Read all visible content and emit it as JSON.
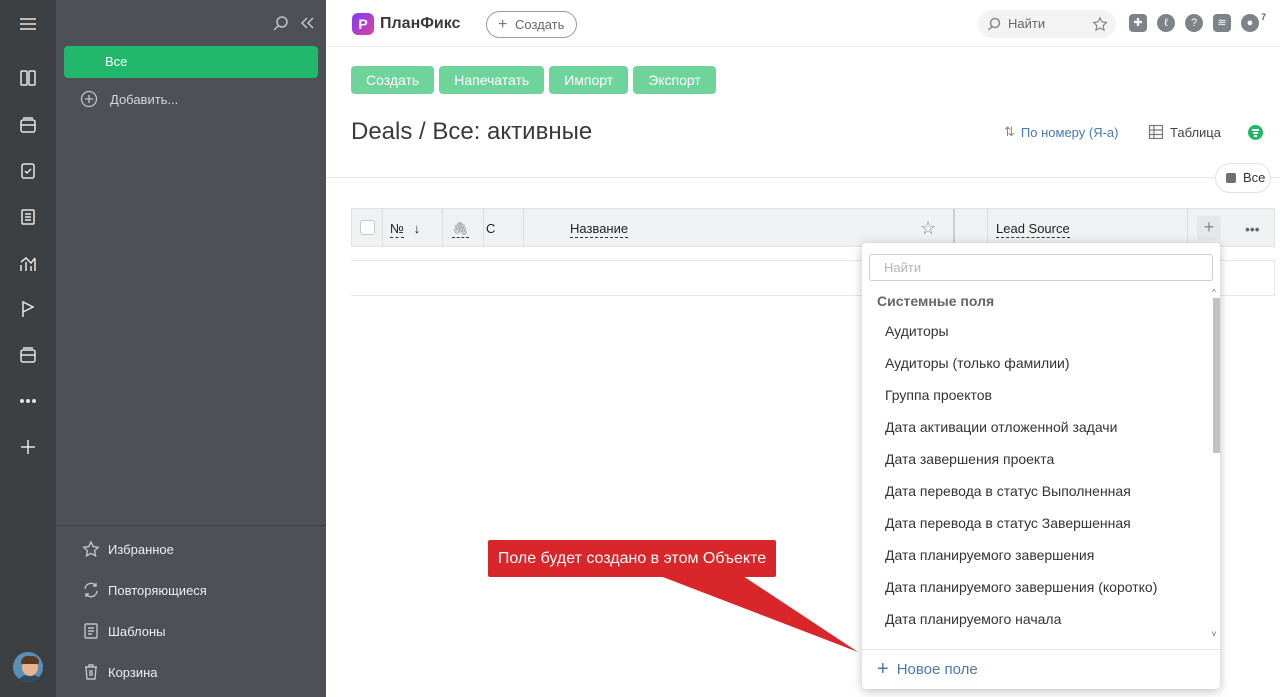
{
  "app": {
    "logo_letter": "P",
    "name": "ПланФикс"
  },
  "header": {
    "create_label": "Создать",
    "search_label": "Найти",
    "notification_count": "7"
  },
  "sidebar": {
    "items": [
      {
        "label": "Все"
      }
    ],
    "add_label": "Добавить...",
    "bottom": [
      {
        "label": "Избранное",
        "icon": "star-icon"
      },
      {
        "label": "Повторяющиеся",
        "icon": "repeat-icon"
      },
      {
        "label": "Шаблоны",
        "icon": "template-icon"
      },
      {
        "label": "Корзина",
        "icon": "trash-icon"
      }
    ]
  },
  "toolbar": {
    "create": "Создать",
    "print": "Напечатать",
    "import": "Импорт",
    "export": "Экспорт"
  },
  "page": {
    "title": "Deals / Все: активные",
    "sort_label": "По номеру (Я-а)",
    "view_label": "Таблица",
    "filter_chip": "Все"
  },
  "table": {
    "columns": {
      "number": "№",
      "c": "С",
      "name": "Название",
      "lead_source": "Lead Source"
    }
  },
  "dropdown": {
    "search_placeholder": "Найти",
    "group_label": "Системные поля",
    "items": [
      "Аудиторы",
      "Аудиторы (только фамилии)",
      "Группа проектов",
      "Дата активации отложенной задачи",
      "Дата завершения проекта",
      "Дата перевода в статус Выполненная",
      "Дата перевода в статус Завершенная",
      "Дата планируемого завершения",
      "Дата планируемого завершения (коротко)",
      "Дата планируемого начала"
    ],
    "new_field_label": "Новое поле"
  },
  "callout": {
    "text": "Поле будет создано в этом Объекте"
  },
  "colors": {
    "accent_green": "#21b86b",
    "button_green": "#6fd39c",
    "link_blue": "#4a78a9",
    "callout_red": "#d9262a"
  }
}
